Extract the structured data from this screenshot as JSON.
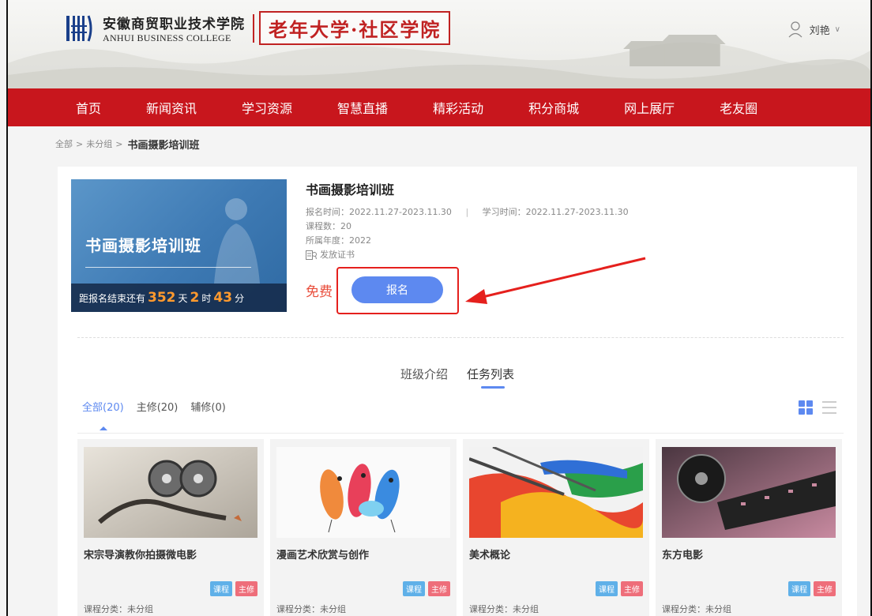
{
  "header": {
    "logo_cn": "安徽商贸职业技术学院",
    "logo_en": "ANHUI BUSINESS COLLEGE",
    "college": "老年大学·社区学院",
    "user_name": "刘艳"
  },
  "nav": {
    "items": [
      "首页",
      "新闻资讯",
      "学习资源",
      "智慧直播",
      "精彩活动",
      "积分商城",
      "网上展厅",
      "老友圈"
    ]
  },
  "breadcrumb": {
    "root": "全部",
    "sep": ">",
    "group": "未分组",
    "current": "书画摄影培训班"
  },
  "course": {
    "cover_title": "书画摄影培训班",
    "countdown_prefix": "距报名结束还有",
    "days": "352",
    "days_unit": "天",
    "hours": "2",
    "hours_unit": "时",
    "minutes": "43",
    "minutes_unit": "分",
    "title": "书画摄影培训班",
    "signup_time": "报名时间：2022.11.27-2023.11.30",
    "pipe": "|",
    "study_time": "学习时间：2022.11.27-2023.11.30",
    "lesson_count": "课程数：20",
    "year": "所属年度：2022",
    "cert": "发放证书",
    "price": "免费",
    "signup_button": "报名"
  },
  "tabs": {
    "intro": "班级介绍",
    "tasks": "任务列表"
  },
  "filters": {
    "all": "全部(20)",
    "major": "主修(20)",
    "minor": "辅修(0)"
  },
  "cards": [
    {
      "title": "宋宗导演教你拍摄微电影",
      "tag1": "课程",
      "tag2": "主修",
      "category": "课程分类：未分组"
    },
    {
      "title": "漫画艺术欣赏与创作",
      "tag1": "课程",
      "tag2": "主修",
      "category": "课程分类：未分组"
    },
    {
      "title": "美术概论",
      "tag1": "课程",
      "tag2": "主修",
      "category": "课程分类：未分组"
    },
    {
      "title": "东方电影",
      "tag1": "课程",
      "tag2": "主修",
      "category": "课程分类：未分组"
    }
  ],
  "colors": {
    "brand_red": "#c8161d",
    "accent_blue": "#5d89f0",
    "price_red": "#e94e3c",
    "annotation_red": "#e5201d"
  }
}
